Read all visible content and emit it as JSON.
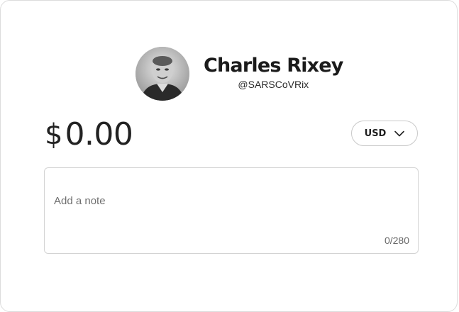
{
  "recipient": {
    "name": "Charles Rixey",
    "handle": "@SARSCoVRix"
  },
  "payment": {
    "currency_symbol": "$",
    "amount": "0.00",
    "currency_code": "USD"
  },
  "note": {
    "placeholder": "Add a note",
    "value": "",
    "counter": "0/280"
  },
  "icons": {
    "currency_toggle": "chevron-down-icon"
  }
}
